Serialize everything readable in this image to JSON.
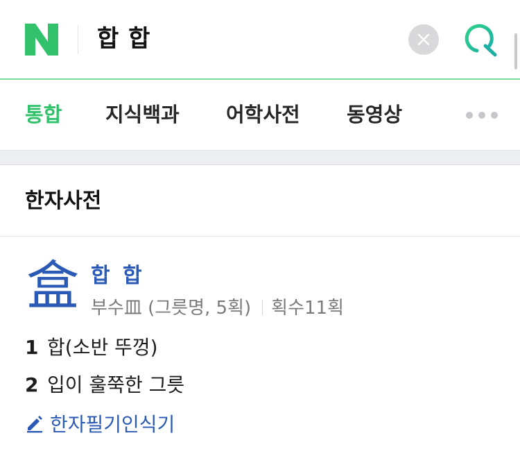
{
  "search": {
    "logo_letter": "N",
    "query": "합 합",
    "brand_color": "#31c26b",
    "icons": [
      "naver-logo-icon",
      "clear-icon",
      "search-icon"
    ]
  },
  "tabs": {
    "items": [
      {
        "label": "통합",
        "active": true
      },
      {
        "label": "지식백과",
        "active": false
      },
      {
        "label": "어학사전",
        "active": false
      },
      {
        "label": "동영상",
        "active": false
      }
    ],
    "more_icon": "more-dots-icon"
  },
  "dictionary": {
    "title": "한자사전",
    "entry": {
      "character": "盒",
      "reading": "합 합",
      "radical": "부수皿 (그릇명, 5획)",
      "strokes": "획수11획",
      "accent_color": "#2a5ab5",
      "meanings": [
        {
          "num": "1",
          "text": "합(소반 뚜껑)"
        },
        {
          "num": "2",
          "text": "입이 훌쭉한 그릇"
        }
      ]
    },
    "write_link": {
      "label": "한자필기인식기",
      "icon": "pencil-icon"
    }
  }
}
